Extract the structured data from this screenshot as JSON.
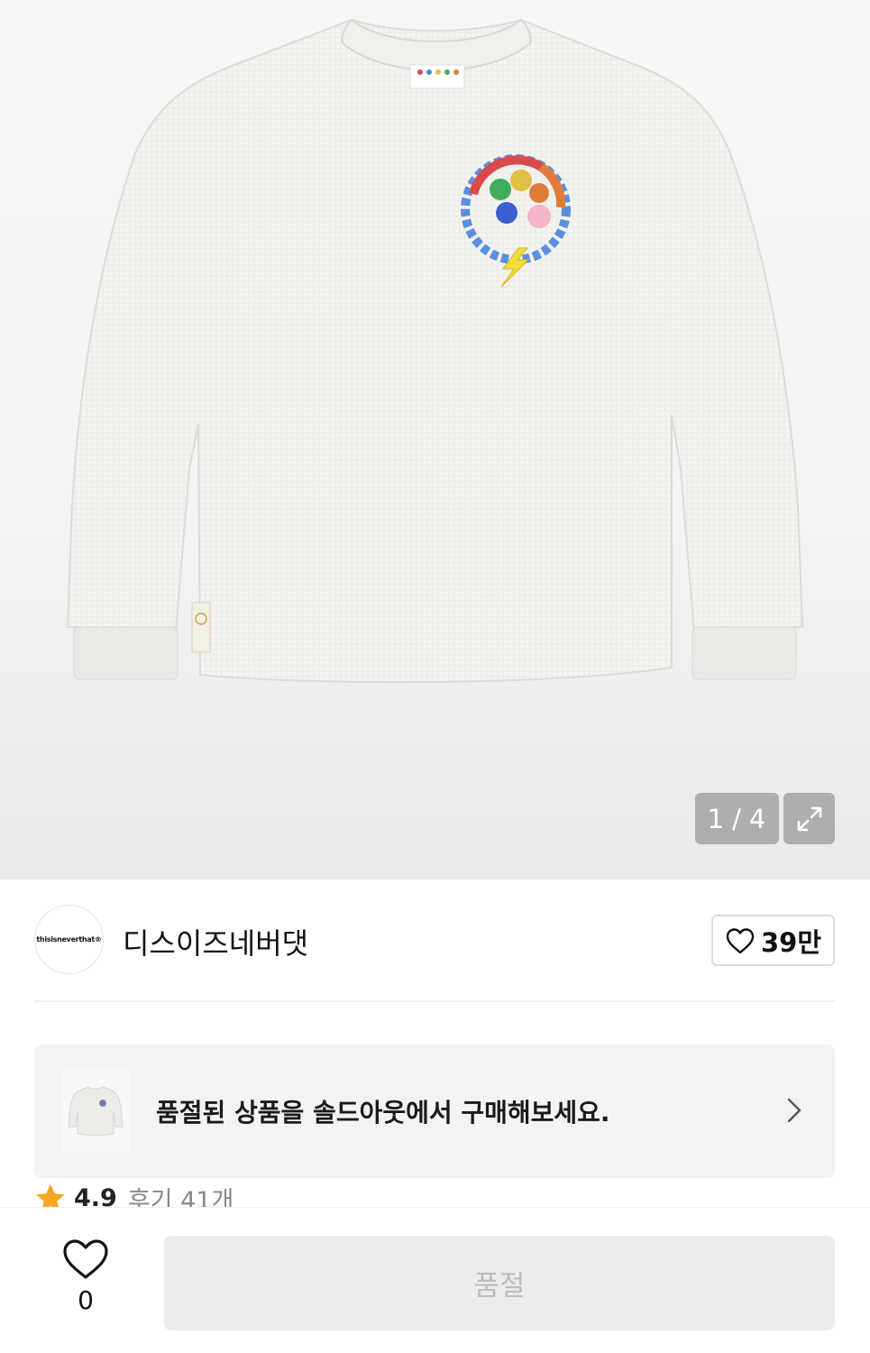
{
  "gallery": {
    "current": "1",
    "separator": "/",
    "total": "4"
  },
  "brand": {
    "logo_text": "thisisneverthat®",
    "name": "디스이즈네버댓",
    "like_count": "39만"
  },
  "soldout_banner": {
    "text": "품절된 상품을 솔드아웃에서 구매해보세요."
  },
  "rating": {
    "score": "4.9",
    "reviews": "후기 41개"
  },
  "bottom_bar": {
    "wish_count": "0",
    "buy_label": "품절"
  },
  "colors": {
    "star": "#f5a623",
    "disabled_button": "#ececec",
    "disabled_text": "#bdbdbd",
    "banner_bg": "#f3f3f3"
  }
}
